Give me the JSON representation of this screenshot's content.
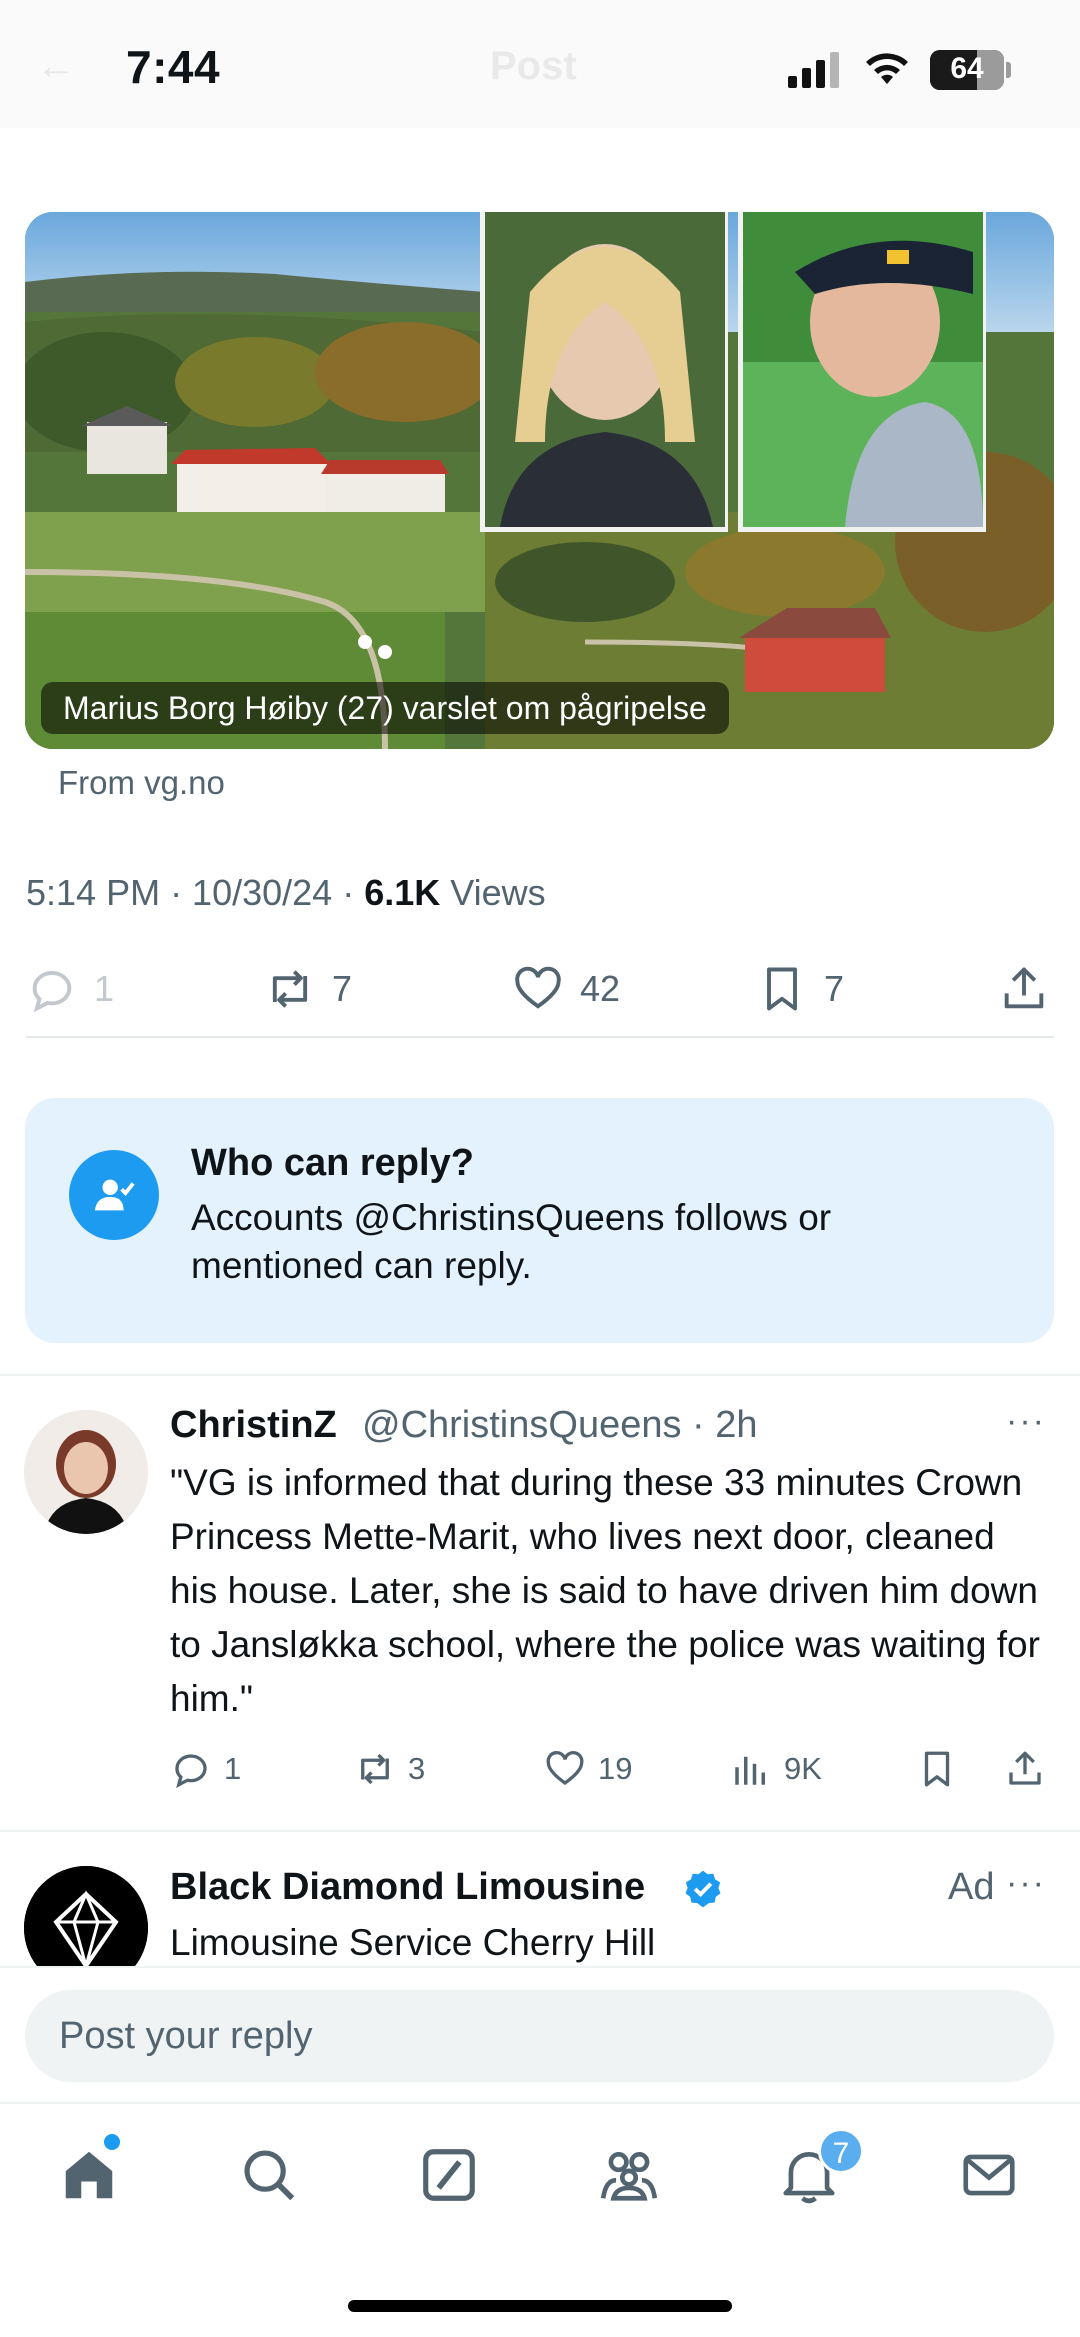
{
  "status_bar": {
    "time": "7:44",
    "battery": "64",
    "battery_level": 0.64
  },
  "header": {
    "title": "Post"
  },
  "post": {
    "link_card": {
      "caption": "Marius Borg Høiby (27) varslet om pågripelse",
      "source": "From vg.no"
    },
    "timestamp": "5:14 PM · 10/30/24 · ",
    "views_count": "6.1K",
    "views_label": " Views",
    "actions": {
      "replies": "1",
      "reposts": "7",
      "likes": "42",
      "bookmarks": "7"
    }
  },
  "who_can_reply": {
    "title": "Who can reply?",
    "body": "Accounts @ChristinsQueens follows or mentioned can reply."
  },
  "reply_tweet": {
    "name": "ChristinZ",
    "handle": "@ChristinsQueens · 2h",
    "more": "···",
    "text": "\"VG is informed that during these 33 minutes Crown Princess Mette-Marit, who lives next door, cleaned his house. Later, she is said to have driven him down to Jansløkka school, where the police was waiting for him.\"",
    "actions": {
      "replies": "1",
      "reposts": "3",
      "likes": "19",
      "views": "9K"
    }
  },
  "ad": {
    "name": "Black Diamond Limousine",
    "tag": "Ad",
    "more": "···",
    "text": "Limousine Service Cherry Hill"
  },
  "reply_bar": {
    "placeholder": "Post your reply"
  },
  "tab_bar": {
    "items": [
      "home-icon",
      "search-icon",
      "grok-icon",
      "communities-icon",
      "notifications-icon",
      "messages-icon"
    ],
    "notifications_badge": "7"
  },
  "colors": {
    "accent": "#1d9bf0",
    "secondary_text": "#536471",
    "info_bg": "#e4f2fd"
  }
}
